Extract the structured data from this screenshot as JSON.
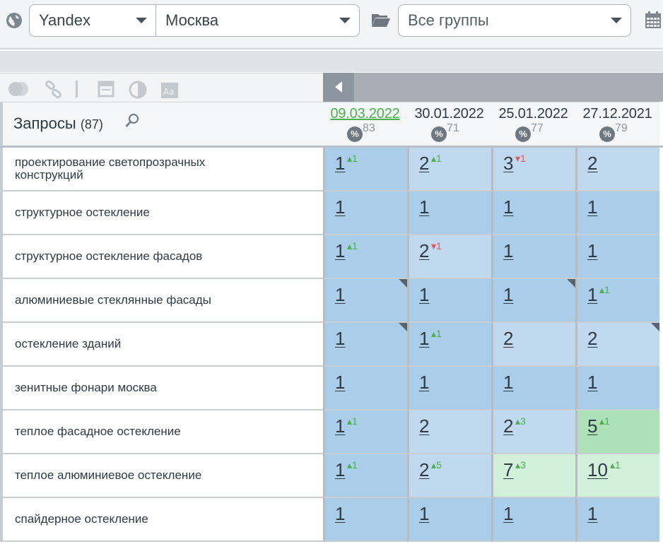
{
  "toolbar": {
    "search_engine": "Yandex",
    "region": "Москва",
    "group": "Все группы"
  },
  "queries_header": {
    "title": "Запросы",
    "count": "(87)"
  },
  "dates": [
    {
      "label": "09.03.2022",
      "percent": "83",
      "active": true
    },
    {
      "label": "30.01.2022",
      "percent": "71",
      "active": false
    },
    {
      "label": "25.01.2022",
      "percent": "77",
      "active": false
    },
    {
      "label": "27.12.2021",
      "percent": "79",
      "active": false
    }
  ],
  "rows": [
    {
      "query": "проектирование светопрозрачных конструкций",
      "cells": [
        {
          "pos": "1",
          "delta": "1",
          "dir": "up"
        },
        {
          "pos": "2",
          "delta": "1",
          "dir": "up"
        },
        {
          "pos": "3",
          "delta": "1",
          "dir": "down"
        },
        {
          "pos": "2",
          "delta": "",
          "dir": ""
        }
      ]
    },
    {
      "query": "структурное остекление",
      "cells": [
        {
          "pos": "1",
          "delta": "",
          "dir": ""
        },
        {
          "pos": "1",
          "delta": "",
          "dir": ""
        },
        {
          "pos": "1",
          "delta": "",
          "dir": ""
        },
        {
          "pos": "1",
          "delta": "",
          "dir": ""
        }
      ]
    },
    {
      "query": "структурное остекление фасадов",
      "cells": [
        {
          "pos": "1",
          "delta": "1",
          "dir": "up"
        },
        {
          "pos": "2",
          "delta": "1",
          "dir": "down"
        },
        {
          "pos": "1",
          "delta": "",
          "dir": ""
        },
        {
          "pos": "1",
          "delta": "",
          "dir": ""
        }
      ]
    },
    {
      "query": "алюминиевые стеклянные фасады",
      "cells": [
        {
          "pos": "1",
          "delta": "",
          "dir": "",
          "corner": true
        },
        {
          "pos": "1",
          "delta": "",
          "dir": ""
        },
        {
          "pos": "1",
          "delta": "",
          "dir": "",
          "corner": true
        },
        {
          "pos": "1",
          "delta": "1",
          "dir": "up"
        }
      ]
    },
    {
      "query": "остекление зданий",
      "cells": [
        {
          "pos": "1",
          "delta": "",
          "dir": "",
          "corner": true
        },
        {
          "pos": "1",
          "delta": "1",
          "dir": "up"
        },
        {
          "pos": "2",
          "delta": "",
          "dir": ""
        },
        {
          "pos": "2",
          "delta": "",
          "dir": "",
          "corner": true
        }
      ]
    },
    {
      "query": "зенитные фонари москва",
      "cells": [
        {
          "pos": "1",
          "delta": "",
          "dir": ""
        },
        {
          "pos": "1",
          "delta": "",
          "dir": ""
        },
        {
          "pos": "1",
          "delta": "",
          "dir": ""
        },
        {
          "pos": "1",
          "delta": "",
          "dir": ""
        }
      ]
    },
    {
      "query": "теплое фасадное остекление",
      "cells": [
        {
          "pos": "1",
          "delta": "1",
          "dir": "up"
        },
        {
          "pos": "2",
          "delta": "",
          "dir": ""
        },
        {
          "pos": "2",
          "delta": "3",
          "dir": "up"
        },
        {
          "pos": "5",
          "delta": "1",
          "dir": "up"
        }
      ]
    },
    {
      "query": "теплое алюминиевое остекление",
      "cells": [
        {
          "pos": "1",
          "delta": "1",
          "dir": "up"
        },
        {
          "pos": "2",
          "delta": "5",
          "dir": "up"
        },
        {
          "pos": "7",
          "delta": "3",
          "dir": "up"
        },
        {
          "pos": "10",
          "delta": "1",
          "dir": "up"
        }
      ]
    },
    {
      "query": "спайдерное остекление",
      "cells": [
        {
          "pos": "1",
          "delta": "",
          "dir": ""
        },
        {
          "pos": "1",
          "delta": "",
          "dir": ""
        },
        {
          "pos": "1",
          "delta": "",
          "dir": ""
        },
        {
          "pos": "1",
          "delta": "",
          "dir": ""
        }
      ]
    }
  ],
  "colors": {
    "top1": "#aacde9",
    "top3": "#c1d9ee",
    "top5": "#ade1b8",
    "top10": "#d1efd9",
    "delta_up": "#4caf50",
    "delta_down": "#e05858"
  }
}
